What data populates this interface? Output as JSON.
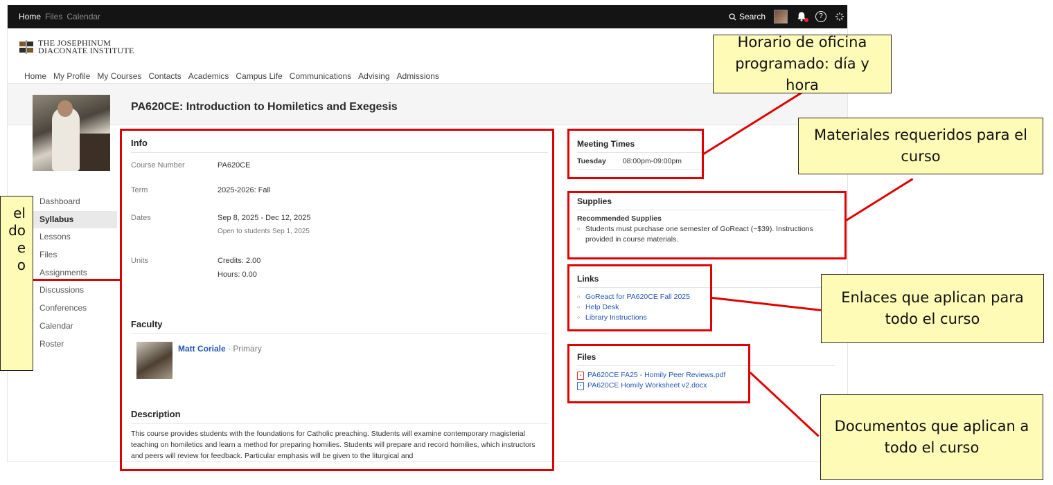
{
  "topbar": {
    "nav": [
      "Home",
      "Files",
      "Calendar"
    ],
    "search_label": "Search"
  },
  "logo": {
    "line1": "THE JOSEPHINUM",
    "line2": "DIACONATE INSTITUTE"
  },
  "main_nav": [
    "Home",
    "My Profile",
    "My Courses",
    "Contacts",
    "Academics",
    "Campus Life",
    "Communications",
    "Advising",
    "Admissions"
  ],
  "course": {
    "title": "PA620CE: Introduction to Homiletics and Exegesis"
  },
  "sidebar": {
    "items": [
      "Dashboard",
      "Syllabus",
      "Lessons",
      "Files",
      "Assignments",
      "Discussions",
      "Conferences",
      "Calendar",
      "Roster"
    ],
    "active": "Syllabus"
  },
  "info": {
    "title": "Info",
    "course_number_label": "Course Number",
    "course_number": "PA620CE",
    "term_label": "Term",
    "term": "2025-2026: Fall",
    "dates_label": "Dates",
    "dates": "Sep 8, 2025 - Dec 12, 2025",
    "dates_sub": "Open to students Sep 1, 2025",
    "units_label": "Units",
    "credits": "Credits: 2.00",
    "hours": "Hours: 0.00"
  },
  "faculty": {
    "title": "Faculty",
    "name": "Matt Coriale",
    "role": "· Primary"
  },
  "description": {
    "title": "Description",
    "text": "This course provides students with the foundations for Catholic preaching. Students will examine contemporary magisterial teaching on homiletics and learn a method for preparing homilies. Students will prepare and record homilies, which instructors and peers will review for feedback. Particular emphasis will be given to the liturgical and"
  },
  "meeting_times": {
    "title": "Meeting Times",
    "day": "Tuesday",
    "time": "08:00pm-09:00pm"
  },
  "supplies": {
    "title": "Supplies",
    "subtitle": "Recommended Supplies",
    "item": "Students must purchase one semester of GoReact (~$39). Instructions provided in course materials."
  },
  "links": {
    "title": "Links",
    "items": [
      "GoReact for PA620CE Fall 2025",
      "Help Desk",
      "Library Instructions"
    ]
  },
  "files": {
    "title": "Files",
    "items": [
      "PA620CE FA25 - Homily Peer Reviews.pdf",
      "PA620CE Homily Worksheet v2.docx"
    ]
  },
  "annotations": {
    "office_hours": "Horario de oficina programado: día y hora",
    "materials": "Materiales requeridos para el curso",
    "links": "Enlaces que aplican para todo el curso",
    "documents": "Documentos que aplican a todo el curso",
    "left_lines": [
      "el",
      "do",
      "e",
      "o"
    ]
  },
  "colors": {
    "highlight": "#e00000",
    "note_bg": "#fdfbb6",
    "link": "#2256b8",
    "topbar": "#141414"
  }
}
